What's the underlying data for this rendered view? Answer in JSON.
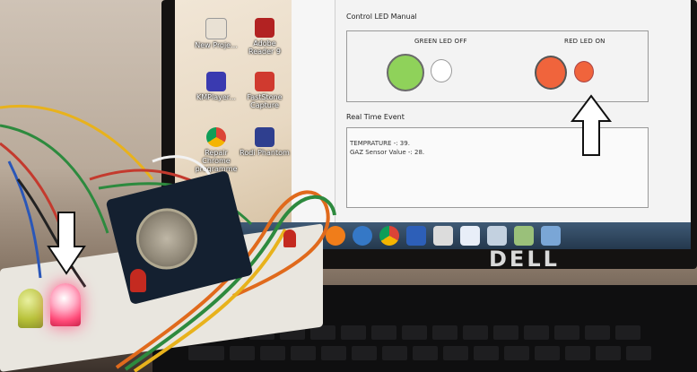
{
  "desktop": {
    "icons": [
      {
        "label": "New Proje...",
        "icon": "project-icon"
      },
      {
        "label": "Adobe Reader 9",
        "icon": "adobe-reader-icon"
      },
      {
        "label": "KMPlayer...",
        "icon": "kmplayer-icon"
      },
      {
        "label": "FastStone Capture",
        "icon": "faststone-icon"
      },
      {
        "label": "Repair Chrome programme",
        "icon": "chrome-icon"
      },
      {
        "label": "Rodi Phantom",
        "icon": "rodi-icon"
      }
    ]
  },
  "app": {
    "control_group_label": "Control LED Manual",
    "green_led_label": "GREEN LED OFF",
    "red_led_label": "RED LED ON",
    "event_group_label": "Real Time Event",
    "event_log": [
      "TEMPRATURE -: 39.",
      "GAZ Sensor Value -: 28."
    ]
  },
  "colors": {
    "green_button": "#8fd25a",
    "green_indicator_off": "#ffffff",
    "red_button": "#f0643c",
    "red_indicator_on": "#f0643c"
  },
  "hardware": {
    "laptop_brand": "DELL"
  }
}
